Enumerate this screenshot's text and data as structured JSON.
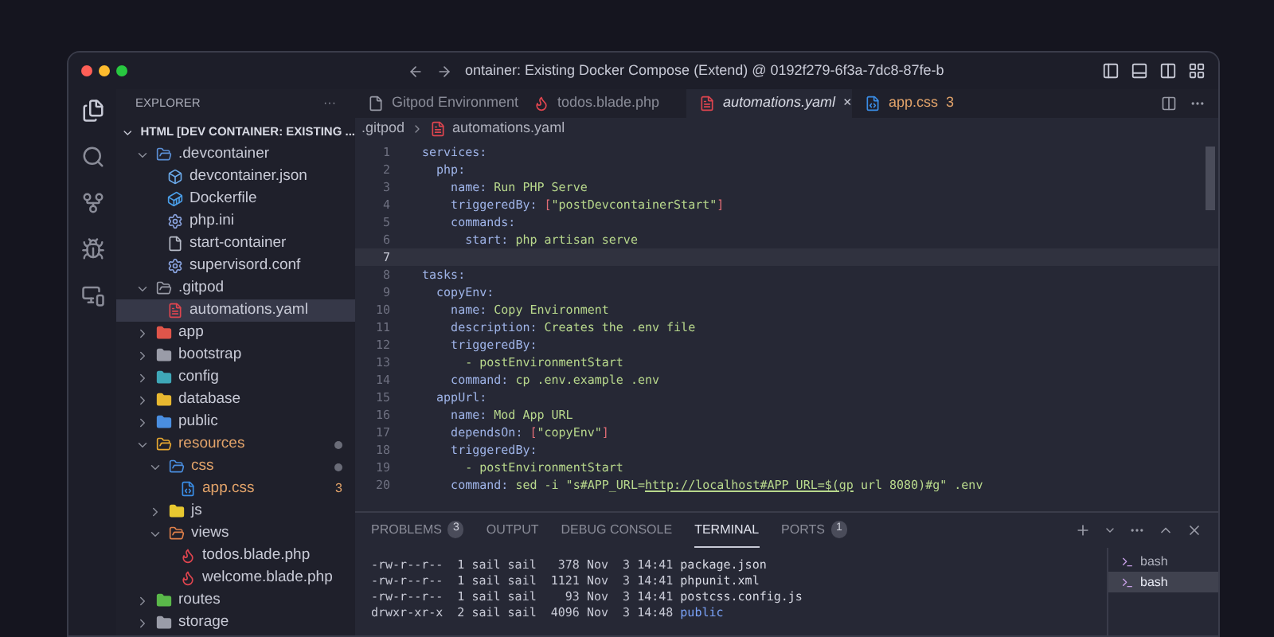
{
  "window": {
    "title": "ontainer: Existing Docker Compose (Extend) @ 0192f279-6f3a-7dc8-87fe-b"
  },
  "sidebar": {
    "title": "EXPLORER",
    "more": "···",
    "root": {
      "label": "HTML [DEV CONTAINER: EXISTING ...",
      "expanded": true
    },
    "items": [
      {
        "label": ".devcontainer",
        "kind": "folder",
        "color": "#5b8fd6",
        "expanded": true,
        "selected": false,
        "modified": false,
        "children": [
          {
            "label": "devcontainer.json",
            "kind": "json",
            "color": "#6aa8e8",
            "selected": false,
            "modified": false
          },
          {
            "label": "Dockerfile",
            "kind": "docker",
            "color": "#4a9ee8",
            "selected": false,
            "modified": false
          },
          {
            "label": "php.ini",
            "kind": "gear",
            "color": "#8aa4e0",
            "selected": false,
            "modified": false
          },
          {
            "label": "start-container",
            "kind": "file",
            "color": "#b8bcc8",
            "selected": false,
            "modified": false
          },
          {
            "label": "supervisord.conf",
            "kind": "gear",
            "color": "#8aa4e0",
            "selected": false,
            "modified": false
          }
        ]
      },
      {
        "label": ".gitpod",
        "kind": "folder",
        "color": "#9a9ca8",
        "expanded": true,
        "selected": false,
        "modified": false,
        "children": [
          {
            "label": "automations.yaml",
            "kind": "yaml",
            "color": "#e0454f",
            "selected": true,
            "modified": false
          }
        ]
      },
      {
        "label": "app",
        "kind": "folder",
        "color": "#e0554a",
        "expanded": false,
        "selected": false,
        "modified": false
      },
      {
        "label": "bootstrap",
        "kind": "folder",
        "color": "#9a9ca8",
        "expanded": false,
        "selected": false,
        "modified": false
      },
      {
        "label": "config",
        "kind": "folder",
        "color": "#3fa8b8",
        "expanded": false,
        "selected": false,
        "modified": false
      },
      {
        "label": "database",
        "kind": "folder",
        "color": "#e8b830",
        "expanded": false,
        "selected": false,
        "modified": false
      },
      {
        "label": "public",
        "kind": "folder",
        "color": "#4a8ee0",
        "expanded": false,
        "selected": false,
        "modified": false
      },
      {
        "label": "resources",
        "kind": "folder",
        "color": "#e8a830",
        "expanded": true,
        "selected": false,
        "modified": true,
        "children": [
          {
            "label": "css",
            "kind": "folder",
            "color": "#4a8ee0",
            "expanded": true,
            "selected": false,
            "modified": true,
            "children": [
              {
                "label": "app.css",
                "kind": "css",
                "color": "#3a8ee8",
                "selected": false,
                "modified": true,
                "badge": "3"
              }
            ]
          },
          {
            "label": "js",
            "kind": "folder",
            "color": "#e8c830",
            "expanded": false,
            "selected": false,
            "modified": false
          },
          {
            "label": "views",
            "kind": "folder",
            "color": "#e0804a",
            "expanded": true,
            "selected": false,
            "modified": false,
            "children": [
              {
                "label": "todos.blade.php",
                "kind": "laravel",
                "color": "#e0454f",
                "selected": false,
                "modified": false
              },
              {
                "label": "welcome.blade.php",
                "kind": "laravel",
                "color": "#e0454f",
                "selected": false,
                "modified": false
              }
            ]
          }
        ]
      },
      {
        "label": "routes",
        "kind": "folder",
        "color": "#5ab84a",
        "expanded": false,
        "selected": false,
        "modified": false
      },
      {
        "label": "storage",
        "kind": "folder",
        "color": "#9a9ca8",
        "expanded": false,
        "selected": false,
        "modified": false
      }
    ]
  },
  "tabs": [
    {
      "label": "Gitpod Environment",
      "kind": "file",
      "color": "#9a9ca8",
      "selected": false,
      "modified": false
    },
    {
      "label": "todos.blade.php",
      "kind": "laravel",
      "color": "#e0454f",
      "selected": false,
      "modified": false
    },
    {
      "label": "automations.yaml",
      "kind": "yaml",
      "color": "#e0454f",
      "selected": true,
      "modified": false,
      "close": "×"
    },
    {
      "label": "app.css",
      "kind": "css",
      "color": "#3a8ee8",
      "selected": false,
      "modified": true,
      "badge": "3"
    }
  ],
  "breadcrumb": [
    {
      "label": ".gitpod",
      "kind": "folder"
    },
    {
      "label": "automations.yaml",
      "kind": "yaml",
      "color": "#e0454f"
    }
  ],
  "editor": {
    "lines": [
      {
        "number": "1",
        "current": false,
        "tokens": [
          {
            "kind": "key",
            "text": "services:"
          }
        ]
      },
      {
        "number": "2",
        "current": false,
        "tokens": [
          {
            "kind": "key",
            "text": "  php:"
          }
        ]
      },
      {
        "number": "3",
        "current": false,
        "tokens": [
          {
            "kind": "key",
            "text": "    name:"
          },
          {
            "kind": "value",
            "text": " Run PHP Serve"
          }
        ]
      },
      {
        "number": "4",
        "current": false,
        "tokens": [
          {
            "kind": "key",
            "text": "    triggeredBy: "
          },
          {
            "kind": "bracket",
            "text": "["
          },
          {
            "kind": "value",
            "text": "\"postDevcontainerStart\""
          },
          {
            "kind": "bracket",
            "text": "]"
          }
        ]
      },
      {
        "number": "5",
        "current": false,
        "tokens": [
          {
            "kind": "key",
            "text": "    commands:"
          }
        ]
      },
      {
        "number": "6",
        "current": false,
        "tokens": [
          {
            "kind": "key",
            "text": "      start:"
          },
          {
            "kind": "value",
            "text": " php artisan serve"
          }
        ]
      },
      {
        "number": "7",
        "current": true
      },
      {
        "number": "8",
        "current": false,
        "tokens": [
          {
            "kind": "key",
            "text": "tasks:"
          }
        ]
      },
      {
        "number": "9",
        "current": false,
        "tokens": [
          {
            "kind": "key",
            "text": "  copyEnv:"
          }
        ]
      },
      {
        "number": "10",
        "current": false,
        "tokens": [
          {
            "kind": "key",
            "text": "    name:"
          },
          {
            "kind": "value",
            "text": " Copy Environment"
          }
        ]
      },
      {
        "number": "11",
        "current": false,
        "tokens": [
          {
            "kind": "key",
            "text": "    description:"
          },
          {
            "kind": "value",
            "text": " Creates the .env file"
          }
        ]
      },
      {
        "number": "12",
        "current": false,
        "tokens": [
          {
            "kind": "key",
            "text": "    triggeredBy:"
          }
        ]
      },
      {
        "number": "13",
        "current": false,
        "tokens": [
          {
            "kind": "value",
            "text": "      - postEnvironmentStart"
          }
        ]
      },
      {
        "number": "14",
        "current": false,
        "tokens": [
          {
            "kind": "key",
            "text": "    command:"
          },
          {
            "kind": "value",
            "text": " cp .env.example .env"
          }
        ]
      },
      {
        "number": "15",
        "current": false,
        "tokens": [
          {
            "kind": "key",
            "text": "  appUrl:"
          }
        ]
      },
      {
        "number": "16",
        "current": false,
        "tokens": [
          {
            "kind": "key",
            "text": "    name:"
          },
          {
            "kind": "value",
            "text": " Mod App URL"
          }
        ]
      },
      {
        "number": "17",
        "current": false,
        "tokens": [
          {
            "kind": "key",
            "text": "    dependsOn: "
          },
          {
            "kind": "bracket",
            "text": "["
          },
          {
            "kind": "value",
            "text": "\"copyEnv\""
          },
          {
            "kind": "bracket",
            "text": "]"
          }
        ]
      },
      {
        "number": "18",
        "current": false,
        "tokens": [
          {
            "kind": "key",
            "text": "    triggeredBy:"
          }
        ]
      },
      {
        "number": "19",
        "current": false,
        "tokens": [
          {
            "kind": "value",
            "text": "      - postEnvironmentStart"
          }
        ]
      },
      {
        "number": "20",
        "current": false,
        "tokens": [
          {
            "kind": "key",
            "text": "    command:"
          },
          {
            "kind": "value",
            "text": " sed -i \"s#APP_URL="
          },
          {
            "kind": "link",
            "text": "http://localhost#APP_URL=$(gp"
          },
          {
            "kind": "value",
            "text": " url 8080)#g\" .env"
          }
        ]
      }
    ]
  },
  "panel": {
    "tabs": [
      {
        "label": "PROBLEMS",
        "count": "3",
        "selected": false
      },
      {
        "label": "OUTPUT",
        "selected": false
      },
      {
        "label": "DEBUG CONSOLE",
        "selected": false
      },
      {
        "label": "TERMINAL",
        "selected": true
      },
      {
        "label": "PORTS",
        "count": "1",
        "selected": false
      }
    ],
    "terminal_lines": [
      {
        "meta": "-rw-r--r--  1 sail sail   378 Nov  3 14:41 ",
        "name": "package.json",
        "kind": "file"
      },
      {
        "meta": "-rw-r--r--  1 sail sail  1121 Nov  3 14:41 ",
        "name": "phpunit.xml",
        "kind": "file"
      },
      {
        "meta": "-rw-r--r--  1 sail sail    93 Nov  3 14:41 ",
        "name": "postcss.config.js",
        "kind": "file"
      },
      {
        "meta": "drwxr-xr-x  2 sail sail  4096 Nov  3 14:48 ",
        "name": "public",
        "kind": "dir"
      }
    ],
    "terminals": [
      {
        "label": "bash",
        "selected": false
      },
      {
        "label": "bash",
        "selected": true
      }
    ]
  }
}
